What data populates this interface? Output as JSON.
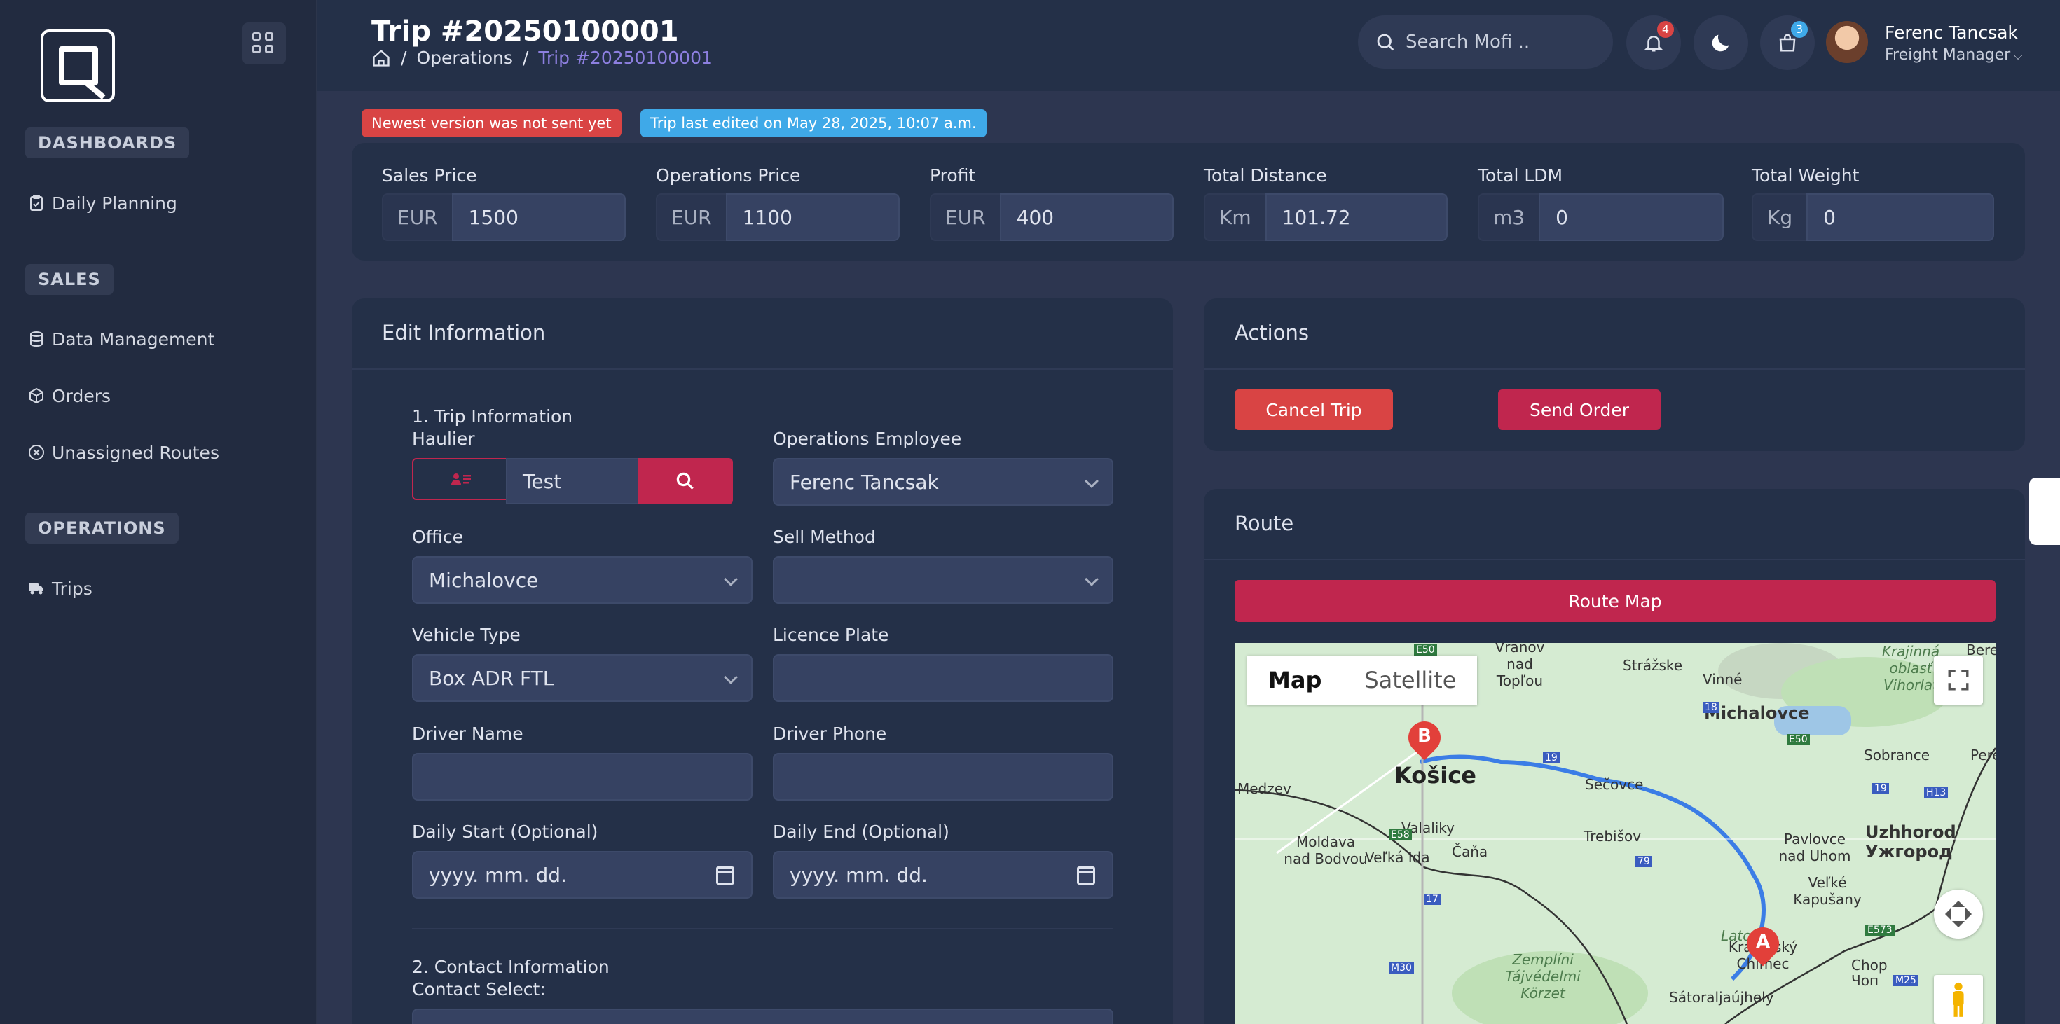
{
  "sidebar": {
    "sections": [
      {
        "title": "DASHBOARDS",
        "items": [
          "Daily Planning"
        ]
      },
      {
        "title": "SALES",
        "items": [
          "Data Management",
          "Orders",
          "Unassigned Routes"
        ]
      },
      {
        "title": "OPERATIONS",
        "items": [
          "Trips"
        ]
      }
    ]
  },
  "header": {
    "title": "Trip #20250100001",
    "breadcrumb": [
      "Operations",
      "Trip #20250100001"
    ],
    "search_placeholder": "Search Mofi ..",
    "notifications_count": "4",
    "cart_count": "3",
    "user_name": "Ferenc Tancsak",
    "user_role": "Freight Manager"
  },
  "tags": {
    "warning": "Newest version was not sent yet",
    "info": "Trip last edited on May 28, 2025, 10:07 a.m."
  },
  "colors": {
    "accent": "#c0264e",
    "danger": "#d94444",
    "info": "#3fa9e8",
    "primary": "#8d7fe0"
  },
  "kpis": [
    {
      "label": "Sales Price",
      "unit": "EUR",
      "value": "1500"
    },
    {
      "label": "Operations Price",
      "unit": "EUR",
      "value": "1100"
    },
    {
      "label": "Profit",
      "unit": "EUR",
      "value": "400"
    },
    {
      "label": "Total Distance",
      "unit": "Km",
      "value": "101.72"
    },
    {
      "label": "Total LDM",
      "unit": "m3",
      "value": "0"
    },
    {
      "label": "Total Weight",
      "unit": "Kg",
      "value": "0"
    }
  ],
  "edit": {
    "title": "Edit Information",
    "section1": "1. Trip Information",
    "haulier_label": "Haulier",
    "haulier_value": "Test",
    "ops_employee_label": "Operations Employee",
    "ops_employee_value": "Ferenc Tancsak",
    "office_label": "Office",
    "office_value": "Michalovce",
    "sell_method_label": "Sell Method",
    "sell_method_value": "",
    "vehicle_type_label": "Vehicle Type",
    "vehicle_type_value": "Box ADR FTL",
    "licence_plate_label": "Licence Plate",
    "driver_name_label": "Driver Name",
    "driver_phone_label": "Driver Phone",
    "daily_start_label": "Daily Start (Optional)",
    "daily_end_label": "Daily End (Optional)",
    "date_placeholder": "yyyy. mm. dd.",
    "section2": "2. Contact Information",
    "contact_select_label": "Contact Select:"
  },
  "actions": {
    "title": "Actions",
    "cancel": "Cancel Trip",
    "send": "Send Order"
  },
  "route": {
    "title": "Route",
    "map_button": "Route Map",
    "map_tab": "Map",
    "satellite_tab": "Satellite",
    "labels": [
      "Košice",
      "Michalovce",
      "Sečovce",
      "Trebišov",
      "Medzev",
      "Moldava nad Bodvou",
      "Veľká Ida",
      "Valaliky",
      "Čaňa",
      "Vranov nad Topľou",
      "Strážske",
      "Vinné",
      "Sobrance",
      "Pavlovce nad Uhom",
      "Veľké Kapušany",
      "Uzhhorod",
      "Ужгород",
      "Kráľovský Chlmec",
      "Zemplíni Tájvédelmi Körzet",
      "Sátoraljaújhely",
      "Chop",
      "Чоп",
      "Latorica",
      "Perečyn",
      "Krajinná oblasť Vihorlat",
      "Berezný"
    ],
    "road_labels": [
      "E50",
      "E50",
      "18",
      "19",
      "19",
      "E58",
      "79",
      "17",
      "M30",
      "H13",
      "E573",
      "M25"
    ],
    "pins": [
      "A",
      "B"
    ]
  }
}
